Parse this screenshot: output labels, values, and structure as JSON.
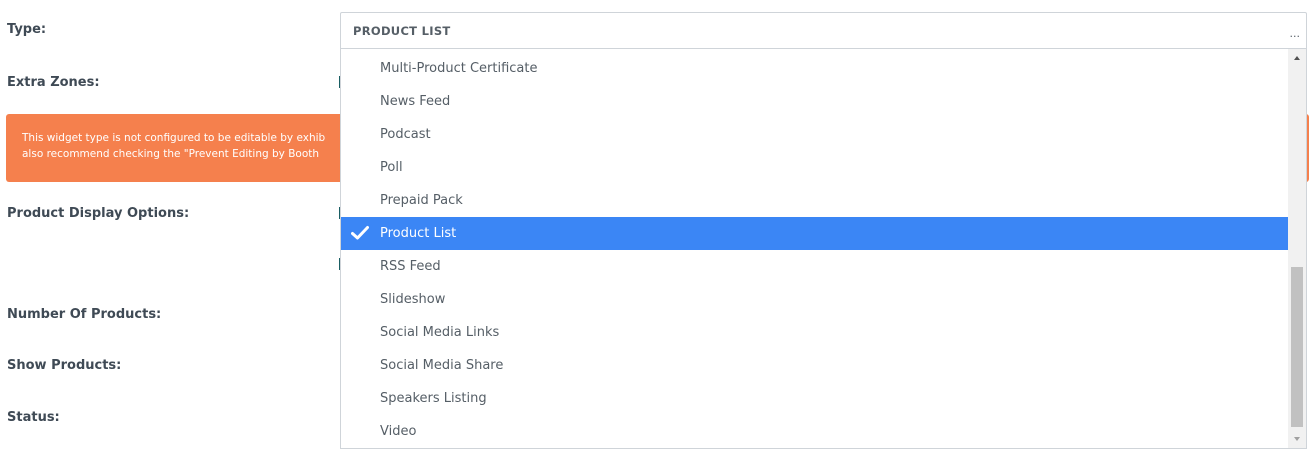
{
  "form": {
    "type_label": "Type:",
    "extra_zones_label": "Extra Zones:",
    "product_display_options_label": "Product Display Options:",
    "number_of_products_label": "Number Of Products:",
    "show_products_label": "Show Products:",
    "status_label": "Status:"
  },
  "alert": {
    "line1": "This widget type is not configured to be editable by exhib",
    "line2": "also recommend checking the \"Prevent Editing by Booth",
    "color": "#f5804d"
  },
  "type_select": {
    "value": "PRODUCT LIST",
    "caret": "...",
    "options": [
      "Multi-Product Certificate",
      "News Feed",
      "Podcast",
      "Poll",
      "Prepaid Pack",
      "Product List",
      "RSS Feed",
      "Slideshow",
      "Social Media Links",
      "Social Media Share",
      "Speakers Listing",
      "Video"
    ],
    "selected_option": "Product List",
    "highlight_color": "#3b86f5"
  }
}
